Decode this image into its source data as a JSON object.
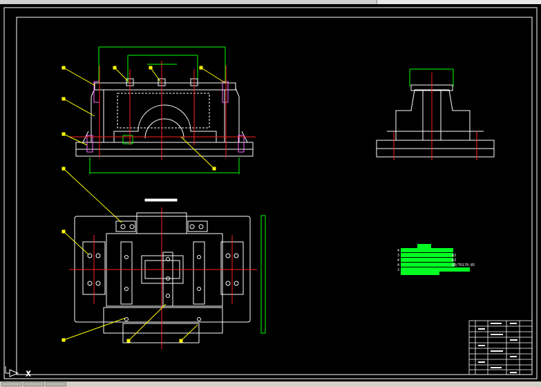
{
  "window": {
    "title": ""
  },
  "colors": {
    "background": "#000000",
    "outline": "#ffffff",
    "centerline": "#ff2020",
    "dimension": "#00ff00",
    "leader": "#ffff00",
    "bolt": "#ff66ff",
    "bom_fill": "#00ff22"
  },
  "icons": {
    "ucs": "ucs-axis-icon"
  },
  "ucs": {
    "x_label": "X"
  },
  "bom_table": {
    "rows": [
      {
        "no": "4",
        "note": ""
      },
      {
        "no": "3",
        "note": "A3"
      },
      {
        "no": "4",
        "note": "A3"
      },
      {
        "no": "4",
        "note": "GB/T6170-85"
      },
      {
        "no": "3",
        "note": ""
      }
    ]
  },
  "status_tabs": [
    "",
    "",
    ""
  ]
}
